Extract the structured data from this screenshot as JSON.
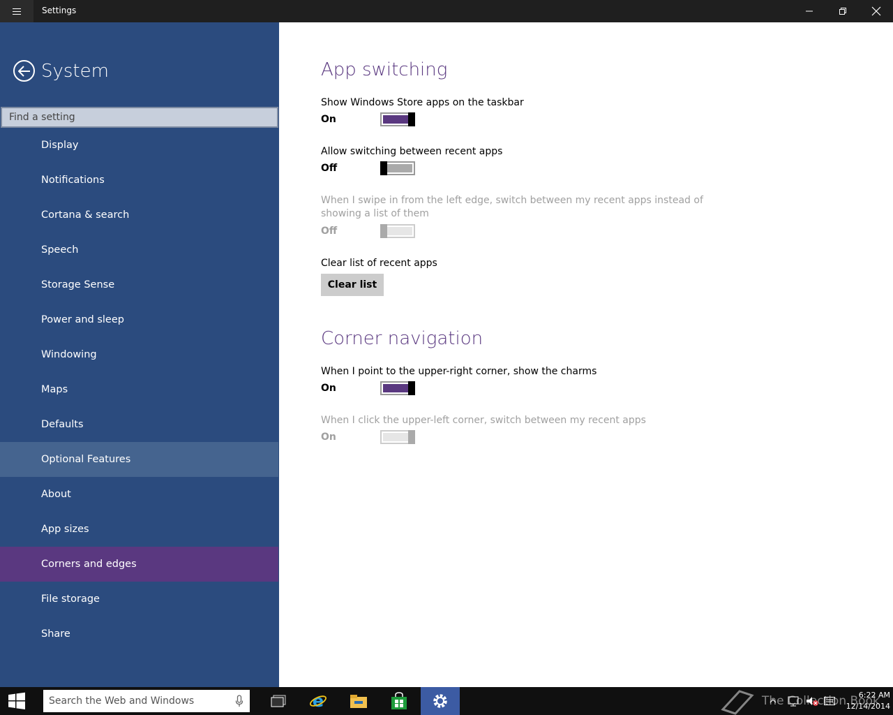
{
  "titlebar": {
    "title": "Settings"
  },
  "sidebar": {
    "section_title": "System",
    "search_placeholder": "Find a setting",
    "items": [
      {
        "label": "Display"
      },
      {
        "label": "Notifications"
      },
      {
        "label": "Cortana & search"
      },
      {
        "label": "Speech"
      },
      {
        "label": "Storage Sense"
      },
      {
        "label": "Power and sleep"
      },
      {
        "label": "Windowing"
      },
      {
        "label": "Maps"
      },
      {
        "label": "Defaults"
      },
      {
        "label": "Optional Features"
      },
      {
        "label": "About"
      },
      {
        "label": "App sizes"
      },
      {
        "label": "Corners and edges"
      },
      {
        "label": "File storage"
      },
      {
        "label": "Share"
      }
    ],
    "selected": "Corners and edges",
    "hovered": "Optional Features"
  },
  "main": {
    "app_switching": {
      "title": "App switching",
      "settings": [
        {
          "label": "Show Windows Store apps on the taskbar",
          "state": "On",
          "enabled": true
        },
        {
          "label": "Allow switching between recent apps",
          "state": "Off",
          "enabled": true
        },
        {
          "label": "When I swipe in from the left edge, switch between my recent apps instead of showing a list of them",
          "state": "Off",
          "enabled": false
        }
      ],
      "clear_label": "Clear list of recent apps",
      "clear_button": "Clear list"
    },
    "corner_navigation": {
      "title": "Corner navigation",
      "settings": [
        {
          "label": "When I point to the upper-right corner, show the charms",
          "state": "On",
          "enabled": true
        },
        {
          "label": "When I click the upper-left corner, switch between my recent apps",
          "state": "On",
          "enabled": false
        }
      ]
    }
  },
  "taskbar": {
    "search_placeholder": "Search the Web and Windows",
    "apps": [
      "task-view-icon",
      "internet-explorer-icon",
      "file-explorer-icon",
      "store-icon",
      "settings-icon"
    ],
    "clock_time": "6:22 AM",
    "clock_date": "12/14/2014",
    "watermark": "The Collection Book"
  },
  "colors": {
    "sidebar_bg": "#2b4b7e",
    "selected_item": "#5a3880",
    "accent": "#5a3880",
    "taskbar_bg": "#101010"
  }
}
